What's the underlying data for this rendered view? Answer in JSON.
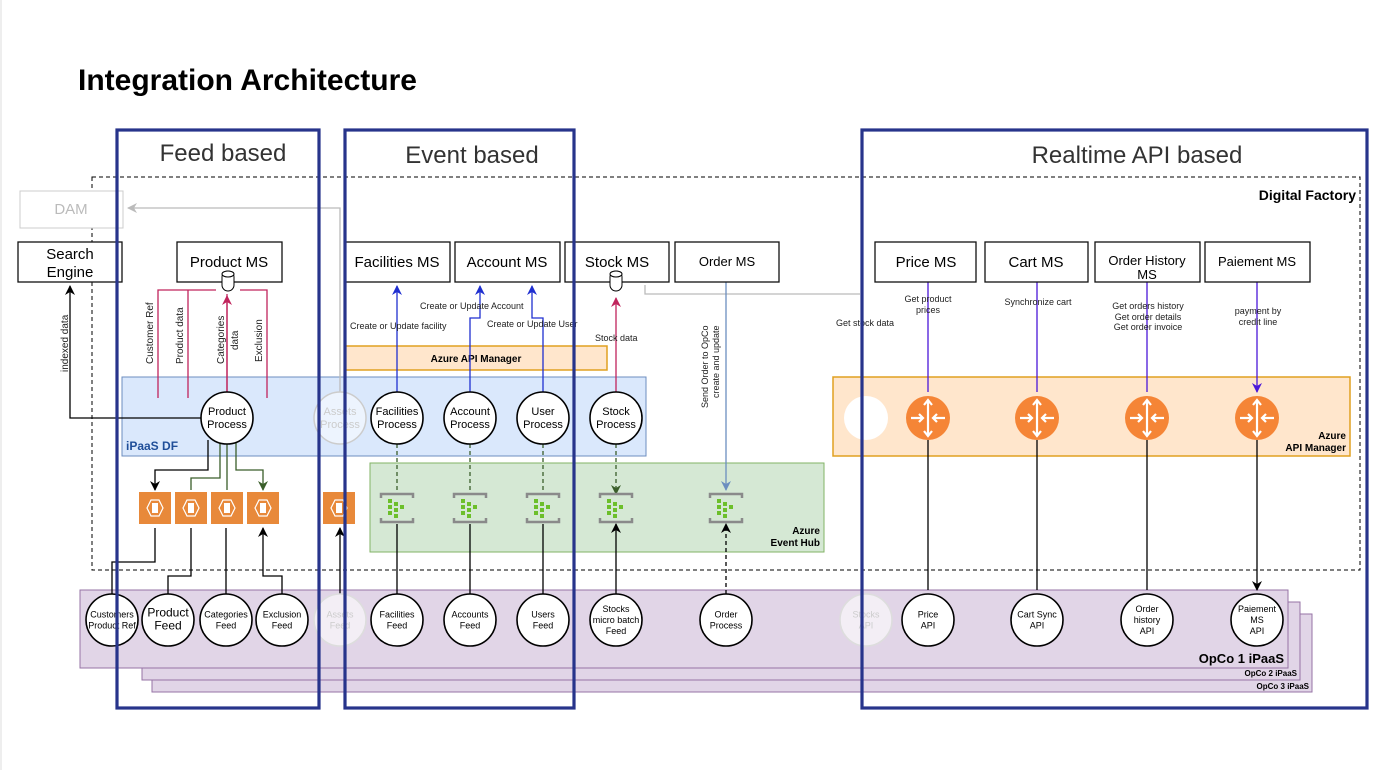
{
  "title": "Integration Architecture",
  "frames": {
    "feed": "Feed based",
    "event": "Event based",
    "realtime": "Realtime API based"
  },
  "zones": {
    "digital_factory": "Digital Factory",
    "ipaas_df": "iPaaS DF",
    "api_mgr_small": "Azure API Manager",
    "api_mgr_right_1": "Azure",
    "api_mgr_right_2": "API Manager",
    "event_hub_1": "Azure",
    "event_hub_2": "Event Hub",
    "opco1": "OpCo 1 iPaaS",
    "opco2": "OpCo 2 iPaaS",
    "opco3": "OpCo 3 iPaaS"
  },
  "systems": {
    "dam": "DAM",
    "search_1": "Search",
    "search_2": "Engine",
    "product": "Product MS",
    "facilities": "Facilities MS",
    "account": "Account MS",
    "stock": "Stock MS",
    "order": "Order MS",
    "price": "Price MS",
    "cart": "Cart MS",
    "order_history_1": "Order History",
    "order_history_2": "MS",
    "paiement": "Paiement MS"
  },
  "processes": {
    "product": [
      "Product",
      "Process"
    ],
    "assets": [
      "Assets",
      "Process"
    ],
    "facilities": [
      "Facilities",
      "Process"
    ],
    "account": [
      "Account",
      "Process"
    ],
    "user": [
      "User",
      "Process"
    ],
    "stock": [
      "Stock",
      "Process"
    ]
  },
  "feeds": {
    "customers": [
      "Customers",
      "Product Ref"
    ],
    "product": [
      "Product",
      "Feed"
    ],
    "categories": [
      "Categories",
      "Feed"
    ],
    "exclusion": [
      "Exclusion",
      "Feed"
    ],
    "assets": [
      "Assets",
      "Feed"
    ],
    "facilities": [
      "Facilities",
      "Feed"
    ],
    "accounts": [
      "Accounts",
      "Feed"
    ],
    "users": [
      "Users",
      "Feed"
    ],
    "stocks": [
      "Stocks",
      "micro batch",
      "Feed"
    ],
    "order": [
      "Order",
      "Process"
    ],
    "stocks_api": [
      "Stocks",
      "API"
    ],
    "price_api": [
      "Price",
      "API"
    ],
    "cart_api": [
      "Cart Sync",
      "API"
    ],
    "order_history_api": [
      "Order",
      "history",
      "API"
    ],
    "paiement_api": [
      "Paiement",
      "MS",
      "API"
    ]
  },
  "edges": {
    "indexed": "indexed data",
    "customer_ref": "Customer Ref",
    "product_data": "Product data",
    "categories_1": "Categories",
    "categories_2": "data",
    "exclusion": "Exclusion",
    "facility": "Create or Update facility",
    "account": "Create or Update Account",
    "user": "Create or Update User",
    "stock": "Stock data",
    "order_1": "Send Order to OpCo",
    "order_2": "create and update",
    "get_stock": "Get stock data",
    "price_1": "Get product",
    "price_2": "prices",
    "cart": "Synchronize cart",
    "oh_1": "Get orders history",
    "oh_2": "Get order details",
    "oh_3": "Get order invoice",
    "pay_1": "payment by",
    "pay_2": "credit line"
  },
  "colors": {
    "frame": "#27348b",
    "ipaas": "#dae8fc",
    "api_mgr": "#ffe6cc",
    "event_hub": "#d5e8d4",
    "opco": "#e1d5e7",
    "router": "#f58536",
    "feed_box": "#e8893a",
    "red_edge": "#c0245c",
    "blue_edge": "#1f2fd0",
    "purple_edge": "#4b17d9"
  }
}
